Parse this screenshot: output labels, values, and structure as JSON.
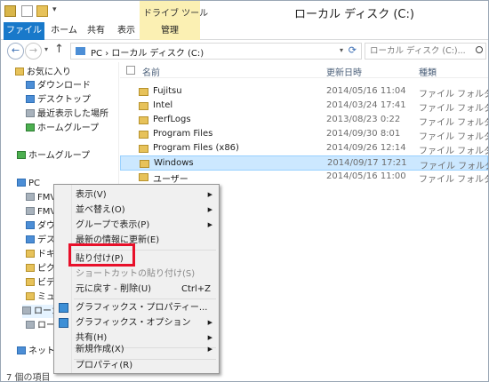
{
  "window": {
    "title": "ローカル ディスク (C:)",
    "context_tab": "ドライブ ツール"
  },
  "ribbon": {
    "tabs": [
      "ファイル",
      "ホーム",
      "共有",
      "表示",
      "管理"
    ]
  },
  "address": {
    "path": "PC › ローカル ディスク (C:)",
    "search_placeholder": "ローカル ディスク (C:)..."
  },
  "nav": {
    "items": [
      {
        "label": "お気に入り",
        "icon": "star-icon"
      },
      {
        "label": "ダウンロード",
        "icon": "download-folder-icon"
      },
      {
        "label": "デスクトップ",
        "icon": "desktop-icon"
      },
      {
        "label": "最近表示した場所",
        "icon": "recent-places-icon"
      },
      {
        "label": "ホームグループ",
        "icon": "homegroup-icon"
      },
      {
        "label": "ホームグループ",
        "icon": "homegroup-icon"
      },
      {
        "label": "PC",
        "icon": "pc-icon"
      },
      {
        "label": "FMV",
        "icon": "drive-icon"
      },
      {
        "label": "FMV",
        "icon": "drive-icon"
      },
      {
        "label": "ダウン",
        "icon": "download-folder-icon"
      },
      {
        "label": "デスク",
        "icon": "desktop-icon"
      },
      {
        "label": "ドキ",
        "icon": "documents-icon"
      },
      {
        "label": "ピクチ",
        "icon": "pictures-icon"
      },
      {
        "label": "ビデオ",
        "icon": "videos-icon"
      },
      {
        "label": "ミュー",
        "icon": "music-icon"
      },
      {
        "label": "ローカ",
        "icon": "local-disk-icon"
      },
      {
        "label": "ローカ",
        "icon": "local-disk-icon"
      },
      {
        "label": "ネットワ",
        "icon": "network-icon"
      }
    ]
  },
  "columns": {
    "name": "名前",
    "date": "更新日時",
    "type": "種類"
  },
  "files": [
    {
      "name": "Fujitsu",
      "date": "2014/05/16 11:04",
      "type": "ファイル フォルダー"
    },
    {
      "name": "Intel",
      "date": "2014/03/24 17:41",
      "type": "ファイル フォルダー"
    },
    {
      "name": "PerfLogs",
      "date": "2013/08/23 0:22",
      "type": "ファイル フォルダー"
    },
    {
      "name": "Program Files",
      "date": "2014/09/30 8:01",
      "type": "ファイル フォルダー"
    },
    {
      "name": "Program Files (x86)",
      "date": "2014/09/26 12:14",
      "type": "ファイル フォルダー"
    },
    {
      "name": "Windows",
      "date": "2014/09/17 17:21",
      "type": "ファイル フォルダー"
    },
    {
      "name": "ユーザー",
      "date": "2014/05/16 11:00",
      "type": "ファイル フォルダー"
    }
  ],
  "context_menu": {
    "items": [
      {
        "label": "表示(V)",
        "submenu": true
      },
      {
        "label": "並べ替え(O)",
        "submenu": true
      },
      {
        "label": "グループで表示(P)",
        "submenu": true
      },
      {
        "label": "最新の情報に更新(E)"
      },
      {
        "label": "貼り付け(P)"
      },
      {
        "label": "ショートカットの貼り付け(S)",
        "disabled": true
      },
      {
        "label": "元に戻す - 削除(U)",
        "shortcut": "Ctrl+Z"
      },
      {
        "label": "グラフィックス・プロパティー..."
      },
      {
        "label": "グラフィックス・オプション",
        "submenu": true
      },
      {
        "label": "共有(H)",
        "submenu": true
      },
      {
        "label": "新規作成(X)",
        "submenu": true
      },
      {
        "label": "プロパティ(R)"
      }
    ]
  },
  "status": {
    "text": "7 個の項目"
  },
  "colors": {
    "accent": "#1979ca",
    "selection": "#cce8ff",
    "highlight_box": "#e8102a",
    "context_band": "#fbf0b3"
  }
}
